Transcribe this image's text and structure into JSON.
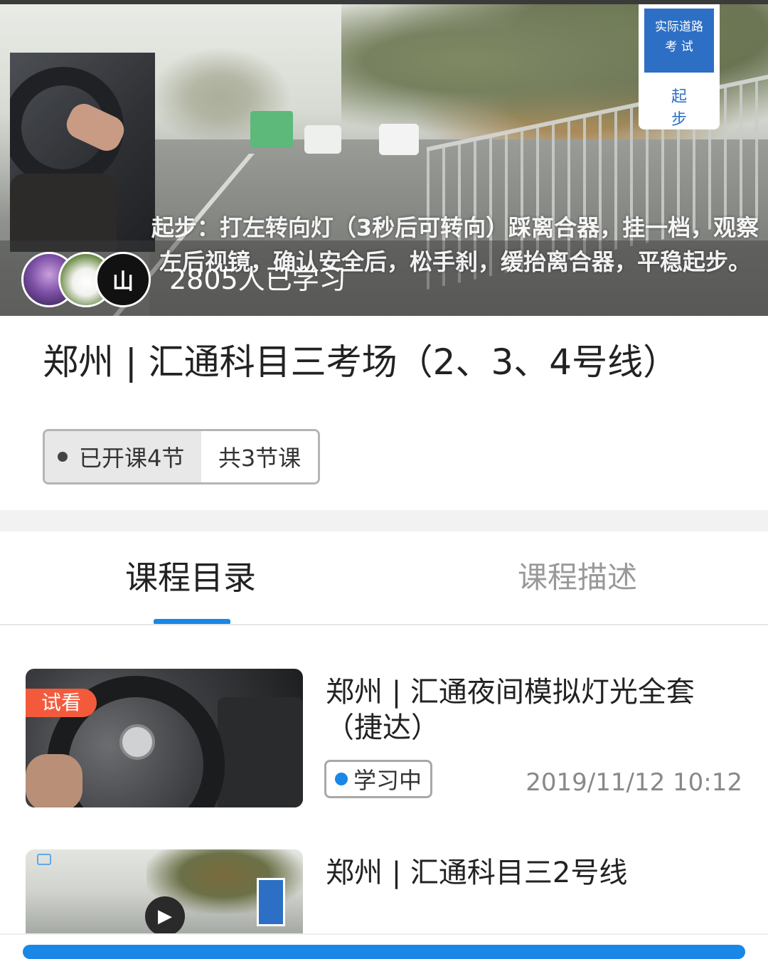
{
  "hero": {
    "sign_line1": "实际道路",
    "sign_line2": "考 试",
    "sign_line3": "起 步",
    "caption": "起步：打左转向灯（3秒后可转向）踩离合器，挂一档，观察左后视镜，确认安全后，松手刹，缓抬离合器，平稳起步。",
    "learners": "2805人已学习",
    "avatar3_text": "山"
  },
  "course": {
    "title": "郑州 | 汇通科目三考场（2、3、4号线）",
    "opened": "已开课4节",
    "total": "共3节课"
  },
  "tabs": [
    {
      "label": "课程目录",
      "active": true
    },
    {
      "label": "课程描述",
      "active": false
    }
  ],
  "lessons": [
    {
      "tag": "试看",
      "title": "郑州 | 汇通夜间模拟灯光全套（捷达）",
      "status": "学习中",
      "date": "2019/11/12 10:12"
    },
    {
      "title": "郑州 | 汇通科目三2号线"
    }
  ],
  "colors": {
    "accent": "#1a86e6",
    "trial_tag": "#f35a3c"
  }
}
